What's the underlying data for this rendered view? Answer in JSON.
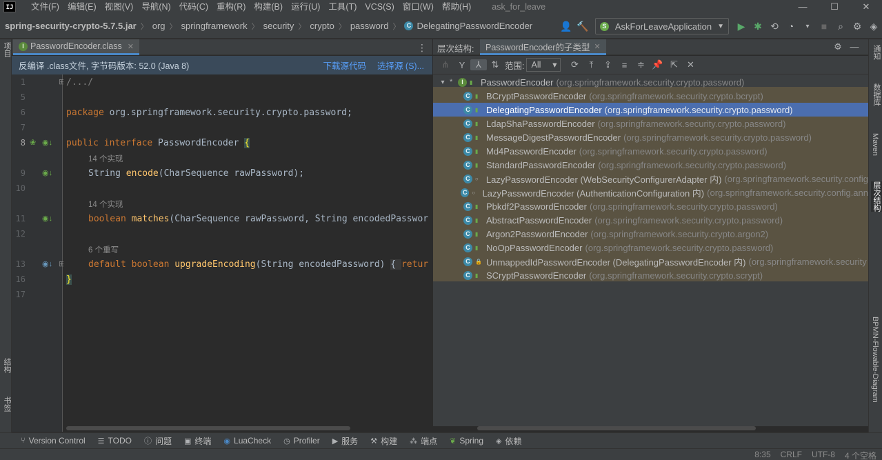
{
  "menu": [
    "文件(F)",
    "编辑(E)",
    "视图(V)",
    "导航(N)",
    "代码(C)",
    "重构(R)",
    "构建(B)",
    "运行(U)",
    "工具(T)",
    "VCS(S)",
    "窗口(W)",
    "帮助(H)"
  ],
  "project_name": "ask_for_leave",
  "logo": "IJ",
  "window_controls": [
    "—",
    "☐",
    "✕"
  ],
  "breadcrumb": [
    "spring-security-crypto-5.7.5.jar",
    "org",
    "springframework",
    "security",
    "crypto",
    "password",
    "DelegatingPasswordEncoder"
  ],
  "run_config": "AskForLeaveApplication",
  "editor": {
    "tab_label": "PasswordEncoder.class",
    "banner_text": "反编译 .class文件, 字节码版本: 52.0 (Java 8)",
    "download_label": "下载源代码",
    "choose_source_label": "选择源 (S)...",
    "line_numbers": [
      "1",
      "5",
      "6",
      "7",
      "8",
      "9",
      "10",
      "11",
      "12",
      "13",
      "16",
      "17"
    ],
    "code": {
      "l1": "/.../",
      "l6_kw": "package",
      "l6_rest": " org.springframework.security.crypto.password;",
      "l8_kw": "public interface",
      "l8_name": " PasswordEncoder ",
      "l8_brace": "{",
      "hint1": "14 个实现",
      "l9_type": "String ",
      "l9_fn": "encode",
      "l9_rest": "(CharSequence rawPassword);",
      "hint2": "14 个实现",
      "l11_kw": "boolean ",
      "l11_fn": "matches",
      "l11_rest": "(CharSequence rawPassword, String encodedPasswor",
      "hint3": "6 个重写",
      "l13_kw": "default boolean ",
      "l13_fn": "upgradeEncoding",
      "l13_rest": "(String encodedPassword) ",
      "l13_fold": "{ ",
      "l13_kw2": "retur",
      "l16": "}"
    }
  },
  "hierarchy": {
    "title": "层次结构:",
    "tab_label": "PasswordEncoder的子类型",
    "scope_label": "范围:",
    "scope_value": "All",
    "root": {
      "name": "PasswordEncoder",
      "pkg": "(org.springframework.security.crypto.password)"
    },
    "items": [
      {
        "name": "BCryptPasswordEncoder",
        "pkg": "(org.springframework.security.crypto.bcrypt)",
        "vis": "public"
      },
      {
        "name": "DelegatingPasswordEncoder",
        "pkg": "(org.springframework.security.crypto.password)",
        "vis": "public"
      },
      {
        "name": "LdapShaPasswordEncoder",
        "pkg": "(org.springframework.security.crypto.password)",
        "vis": "public"
      },
      {
        "name": "MessageDigestPasswordEncoder",
        "pkg": "(org.springframework.security.crypto.password)",
        "vis": "public"
      },
      {
        "name": "Md4PasswordEncoder",
        "pkg": "(org.springframework.security.crypto.password)",
        "vis": "public"
      },
      {
        "name": "StandardPasswordEncoder",
        "pkg": "(org.springframework.security.crypto.password)",
        "vis": "public"
      },
      {
        "name": "LazyPasswordEncoder (WebSecurityConfigurerAdapter 内)",
        "pkg": "(org.springframework.security.config",
        "vis": "package"
      },
      {
        "name": "LazyPasswordEncoder (AuthenticationConfiguration 内)",
        "pkg": "(org.springframework.security.config.ann",
        "vis": "package"
      },
      {
        "name": "Pbkdf2PasswordEncoder",
        "pkg": "(org.springframework.security.crypto.password)",
        "vis": "public"
      },
      {
        "name": "AbstractPasswordEncoder",
        "pkg": "(org.springframework.security.crypto.password)",
        "vis": "public"
      },
      {
        "name": "Argon2PasswordEncoder",
        "pkg": "(org.springframework.security.crypto.argon2)",
        "vis": "public"
      },
      {
        "name": "NoOpPasswordEncoder",
        "pkg": "(org.springframework.security.crypto.password)",
        "vis": "public"
      },
      {
        "name": "UnmappedIdPasswordEncoder (DelegatingPasswordEncoder 内)",
        "pkg": "(org.springframework.security",
        "vis": "private"
      },
      {
        "name": "SCryptPasswordEncoder",
        "pkg": "(org.springframework.security.crypto.scrypt)",
        "vis": "public"
      }
    ],
    "selected_index": 1
  },
  "left_strip": [
    "项目",
    "结构",
    "书签"
  ],
  "right_strip": [
    "通知",
    "数据库",
    "Maven",
    "层次结构",
    "BPMN-Flowable-Diagram"
  ],
  "toolwindows": [
    {
      "icon": "branch-icon",
      "label": "Version Control"
    },
    {
      "icon": "list-icon",
      "label": "TODO"
    },
    {
      "icon": "info-icon",
      "label": "问题"
    },
    {
      "icon": "terminal-icon",
      "label": "终端"
    },
    {
      "icon": "lua-icon",
      "label": "LuaCheck"
    },
    {
      "icon": "profiler-icon",
      "label": "Profiler"
    },
    {
      "icon": "services-icon",
      "label": "服务"
    },
    {
      "icon": "hammer-icon",
      "label": "构建"
    },
    {
      "icon": "endpoints-icon",
      "label": "端点"
    },
    {
      "icon": "spring-icon",
      "label": "Spring"
    },
    {
      "icon": "dependencies-icon",
      "label": "依赖"
    }
  ],
  "status": {
    "position": "8:35",
    "line_sep": "CRLF",
    "encoding": "UTF-8",
    "indent": "4 个空格"
  },
  "colors": {
    "accent": "#4a88c7",
    "selection": "#4b6eaf",
    "keyword": "#cc7832",
    "function": "#ffc66d",
    "highlight_bg": "#5a5342"
  }
}
